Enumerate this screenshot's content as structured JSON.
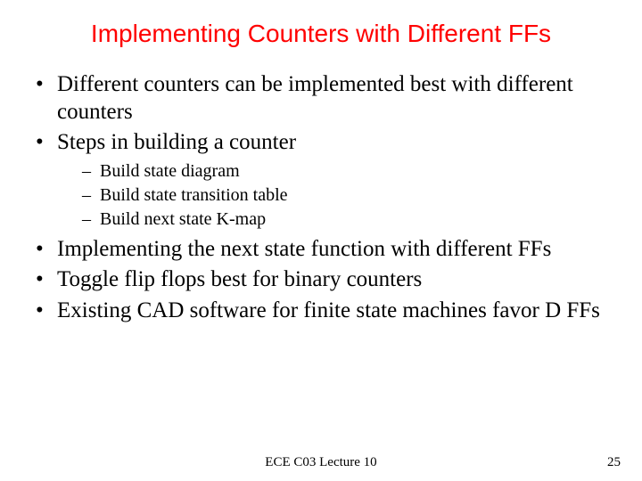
{
  "title": "Implementing Counters with Different FFs",
  "bullets": {
    "b1": "Different counters can be implemented best with different counters",
    "b2": "Steps in building a counter",
    "b2_sub": {
      "s1": "Build state diagram",
      "s2": "Build state transition table",
      "s3": "Build next state K-map"
    },
    "b3": "Implementing the next state function with different FFs",
    "b4": "Toggle flip flops best for binary counters",
    "b5": "Existing CAD software for finite state machines favor D FFs"
  },
  "footer": {
    "center": "ECE C03 Lecture 10",
    "page": "25"
  }
}
